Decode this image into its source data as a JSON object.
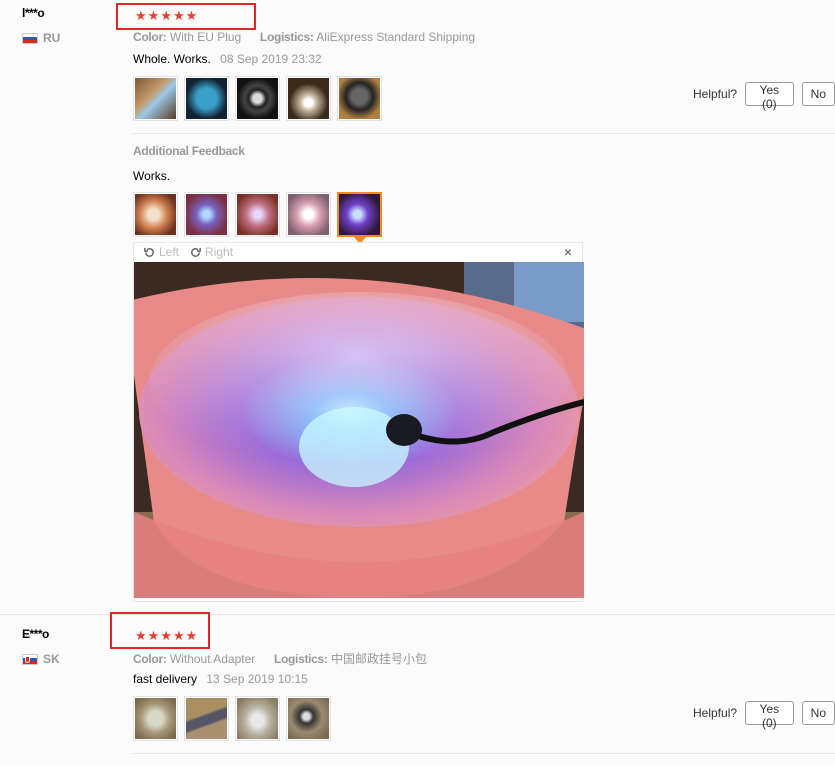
{
  "reviews": [
    {
      "username": "l***o",
      "country": "RU",
      "rating": 5,
      "color_label": "Color:",
      "color_value": "With EU Plug",
      "logistics_label": "Logistics:",
      "logistics_value": "AliExpress Standard Shipping",
      "feedback": "Whole. Works.",
      "date": "08 Sep 2019 23:32",
      "helpful": {
        "label": "Helpful?",
        "yes": "Yes (0)",
        "no": "No"
      },
      "additional": {
        "title": "Additional Feedback",
        "text": "Works.",
        "viewer": {
          "left": "Left",
          "right": "Right",
          "close": "×"
        }
      }
    },
    {
      "username": "E***o",
      "country": "SK",
      "rating": 5,
      "color_label": "Color:",
      "color_value": "Without Adapter",
      "logistics_label": "Logistics:",
      "logistics_value": "中国邮政挂号小包",
      "feedback": "fast delivery",
      "date": "13 Sep 2019 10:15",
      "helpful": {
        "label": "Helpful?",
        "yes": "Yes (0)",
        "no": "No"
      }
    }
  ],
  "icons": {
    "star": "★",
    "rotate_left": "rotate-left-icon",
    "rotate_right": "rotate-right-icon"
  },
  "colors": {
    "star": "#e63f32",
    "highlight_box": "#e0262a",
    "selected_thumb": "#f08a24",
    "meta_gray": "#999999"
  }
}
